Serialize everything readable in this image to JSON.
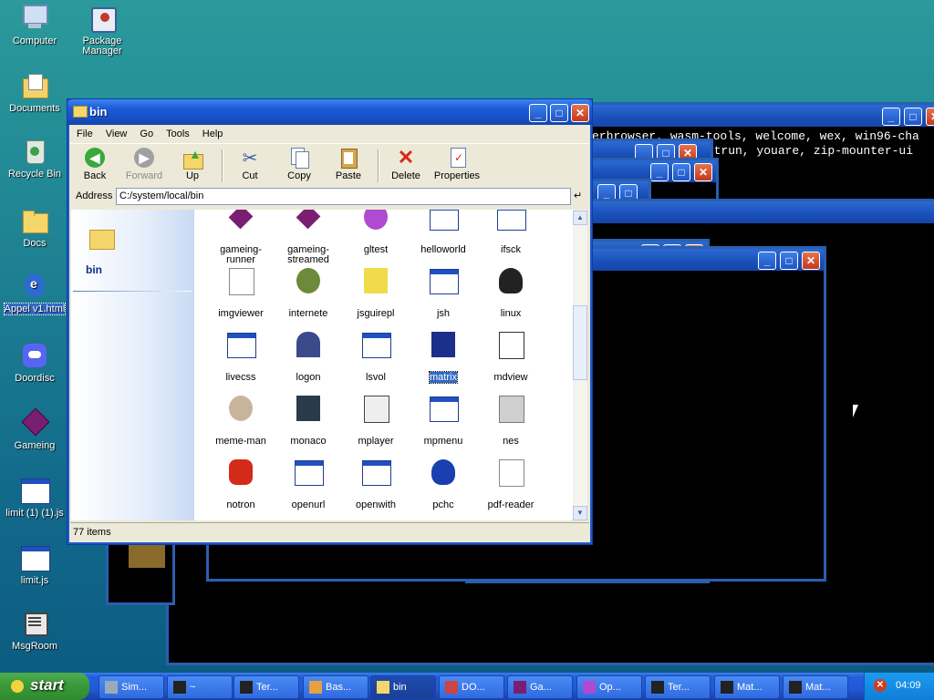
{
  "desktop": {
    "icons": [
      {
        "label": "Computer"
      },
      {
        "label": "Package Manager"
      },
      {
        "label": "Documents"
      },
      {
        "label": "Recycle Bin"
      },
      {
        "label": "Docs"
      },
      {
        "label": "Appel v1.html"
      },
      {
        "label": "Doordisc"
      },
      {
        "label": "Gameing"
      },
      {
        "label": "limit (1) (1).js"
      },
      {
        "label": "limit.js"
      },
      {
        "label": "MsgRoom"
      }
    ]
  },
  "background_windows": {
    "terminal_line1": "erbrowser, wasm-tools, welcome, wex, win96-cha",
    "terminal_line2": "wrtrun, youare, zip-mounter-ui"
  },
  "explorer": {
    "title": "bin",
    "menu": [
      "File",
      "View",
      "Go",
      "Tools",
      "Help"
    ],
    "toolbar": [
      {
        "label": "Back",
        "enabled": true
      },
      {
        "label": "Forward",
        "enabled": false
      },
      {
        "label": "Up",
        "enabled": true
      },
      {
        "label": "Cut",
        "enabled": true
      },
      {
        "label": "Copy",
        "enabled": true
      },
      {
        "label": "Paste",
        "enabled": true
      },
      {
        "label": "Delete",
        "enabled": true
      },
      {
        "label": "Properties",
        "enabled": true
      }
    ],
    "address_label": "Address",
    "address_value": "C:/system/local/bin",
    "left_pane_folder": "bin",
    "files": [
      {
        "name": "gameing-runner"
      },
      {
        "name": "gameing-streamed"
      },
      {
        "name": "gltest"
      },
      {
        "name": "helloworld"
      },
      {
        "name": "ifsck"
      },
      {
        "name": "imgviewer"
      },
      {
        "name": "internete"
      },
      {
        "name": "jsguirepl"
      },
      {
        "name": "jsh"
      },
      {
        "name": "linux"
      },
      {
        "name": "livecss"
      },
      {
        "name": "logon"
      },
      {
        "name": "lsvol"
      },
      {
        "name": "matrix",
        "selected": true
      },
      {
        "name": "mdview"
      },
      {
        "name": "meme-man"
      },
      {
        "name": "monaco"
      },
      {
        "name": "mplayer"
      },
      {
        "name": "mpmenu"
      },
      {
        "name": "nes"
      },
      {
        "name": "notron"
      },
      {
        "name": "openurl"
      },
      {
        "name": "openwith"
      },
      {
        "name": "pchc"
      },
      {
        "name": "pdf-reader"
      }
    ],
    "status": "77 items"
  },
  "taskbar": {
    "start_label": "start",
    "tasks": [
      {
        "label": "Sim..."
      },
      {
        "label": "~"
      },
      {
        "label": "Ter..."
      },
      {
        "label": "Bas..."
      },
      {
        "label": "bin",
        "active": true
      },
      {
        "label": "DO..."
      },
      {
        "label": "Ga..."
      },
      {
        "label": "Op..."
      },
      {
        "label": "Ter..."
      },
      {
        "label": "Mat..."
      },
      {
        "label": "Mat..."
      }
    ],
    "clock": "04:09"
  }
}
